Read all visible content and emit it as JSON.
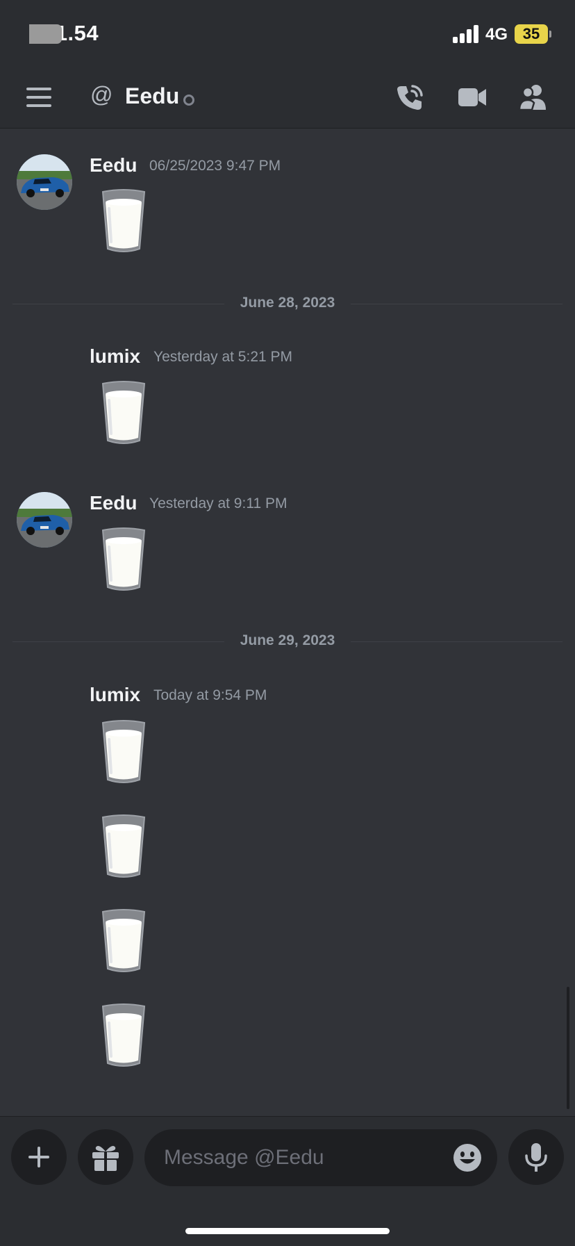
{
  "status_bar": {
    "time": "21.54",
    "network": "4G",
    "battery": "35"
  },
  "header": {
    "title": "Eedu",
    "at_symbol": "@"
  },
  "messages": [
    {
      "author": "Eedu",
      "timestamp": "06/25/2023 9:47 PM",
      "content": "glass-of-milk-emoji"
    },
    {
      "author": "lumix",
      "timestamp": "Yesterday at 5:21 PM",
      "content": "glass-of-milk-emoji"
    },
    {
      "author": "Eedu",
      "timestamp": "Yesterday at 9:11 PM",
      "content": "glass-of-milk-emoji"
    },
    {
      "author": "lumix",
      "timestamp": "Today at 9:54 PM",
      "content": "glass-of-milk-emoji"
    }
  ],
  "dividers": [
    "June 28, 2023",
    "June 29, 2023"
  ],
  "composer": {
    "placeholder": "Message @Eedu"
  },
  "icons": [
    "hamburger-icon",
    "at-icon",
    "call-icon",
    "video-icon",
    "members-icon",
    "plus-icon",
    "gift-icon",
    "emoji-icon",
    "microphone-icon"
  ],
  "colors": {
    "background": "#313338",
    "bar": "#2b2d31",
    "input": "#1e1f22",
    "muted_text": "#949ba4"
  }
}
